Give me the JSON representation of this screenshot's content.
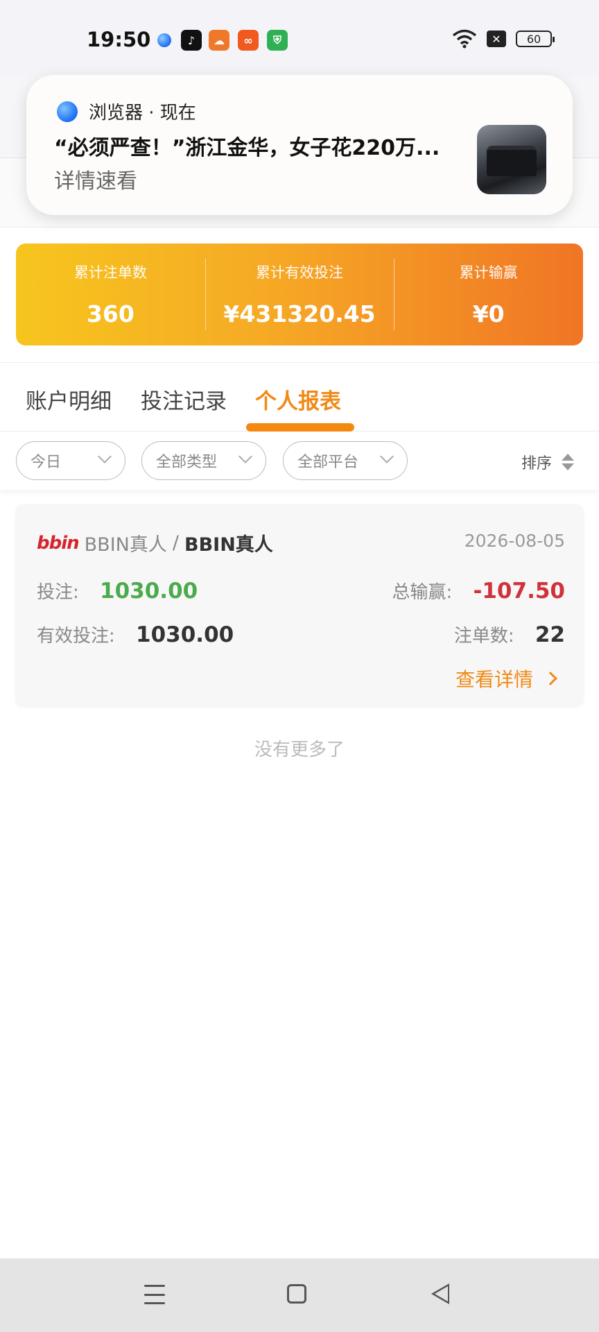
{
  "status_bar": {
    "time": "19:50",
    "battery": "60",
    "app_icons": [
      {
        "name": "browser-icon",
        "color": "#2f7bf0"
      },
      {
        "name": "tiktok-icon",
        "color": "#111111"
      },
      {
        "name": "cloud-icon",
        "color": "#f0782a"
      },
      {
        "name": "kuaishou-icon",
        "color": "#f05a1e"
      },
      {
        "name": "shield-icon",
        "color": "#2fb054"
      }
    ]
  },
  "notification": {
    "app_name": "浏览器 · 现在",
    "title": "“必须严查！”浙江金华，女子花220万...",
    "subtitle": "详情速看"
  },
  "stats": [
    {
      "label": "累计注单数",
      "value": "360"
    },
    {
      "label": "累计有效投注",
      "value": "¥431320.45"
    },
    {
      "label": "累计输赢",
      "value": "¥0"
    }
  ],
  "tabs": [
    {
      "label": "账户明细",
      "active": false
    },
    {
      "label": "投注记录",
      "active": false
    },
    {
      "label": "个人报表",
      "active": true
    }
  ],
  "filters": {
    "date": "今日",
    "type": "全部类型",
    "platform": "全部平台",
    "sort_label": "排序"
  },
  "record": {
    "logo_text": "bbin",
    "platform": "BBIN真人",
    "game": "BBIN真人",
    "date": "2026-08-05",
    "bet_label": "投注:",
    "bet_value": "1030.00",
    "win_label": "总输赢:",
    "win_value": "-107.50",
    "valid_label": "有效投注:",
    "valid_value": "1030.00",
    "count_label": "注单数:",
    "count_value": "22",
    "details_label": "查看详情"
  },
  "footer": {
    "no_more": "没有更多了"
  },
  "colors": {
    "accent": "#f08a16",
    "positive": "#4caa4e",
    "negative": "#d0313a"
  }
}
